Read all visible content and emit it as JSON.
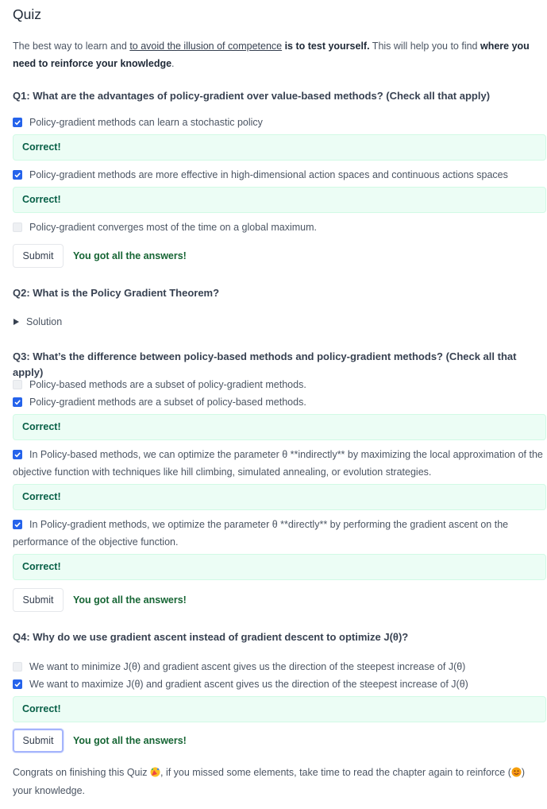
{
  "title": "Quiz",
  "intro": {
    "t1": "The best way to learn and ",
    "link": "to avoid the illusion of competence",
    "t2": " is to test yourself.",
    "t3": " This will help you to find ",
    "t4": "where you need to reinforce your knowledge",
    "t5": "."
  },
  "q1": {
    "title": "Q1: What are the advantages of policy-gradient over value-based methods? (Check all that apply)",
    "options": [
      {
        "label": "Policy-gradient methods can learn a stochastic policy",
        "checked": true
      },
      {
        "label": "Policy-gradient methods are more effective in high-dimensional action spaces and continuous actions spaces",
        "checked": true
      },
      {
        "label": "Policy-gradient converges most of the time on a global maximum.",
        "checked": false
      }
    ]
  },
  "q2": {
    "title": "Q2: What is the Policy Gradient Theorem?",
    "solution": "Solution"
  },
  "q3": {
    "title": "Q3: What’s the difference between policy-based methods and policy-gradient methods? (Check all that apply)",
    "options": [
      {
        "label": "Policy-based methods are a subset of policy-gradient methods.",
        "checked": false
      },
      {
        "label": "Policy-gradient methods are a subset of policy-based methods.",
        "checked": true
      },
      {
        "label": "In Policy-based methods, we can optimize the parameter θ **indirectly** by maximizing the local approximation of the objective function with techniques like hill climbing, simulated annealing, or evolution strategies.",
        "checked": true
      },
      {
        "label": "In Policy-gradient methods, we optimize the parameter θ **directly** by performing the gradient ascent on the performance of the objective function.",
        "checked": true
      }
    ]
  },
  "q4": {
    "title": "Q4: Why do we use gradient ascent instead of gradient descent to optimize J(θ)?",
    "options": [
      {
        "label": "We want to minimize J(θ) and gradient ascent gives us the direction of the steepest increase of J(θ)",
        "checked": false
      },
      {
        "label": "We want to maximize J(θ) and gradient ascent gives us the direction of the steepest increase of J(θ)",
        "checked": true
      }
    ]
  },
  "feedback": {
    "correct": "Correct!",
    "submit": "Submit",
    "all_answers": "You got all the answers!"
  },
  "footer": {
    "t1": "Congrats on finishing this Quiz ",
    "t2": ", if you missed some elements, take time to read the chapter again to reinforce (",
    "t3": ") your knowledge."
  },
  "colors": {
    "accent": "#2563eb",
    "success_bg": "#ecfdf5",
    "success_text": "#065f46",
    "got_text": "#166534"
  },
  "icons": {
    "check": "check-icon",
    "triangle": "triangle-right-icon",
    "party": "party-emoji",
    "smile": "smiling-emoji"
  }
}
